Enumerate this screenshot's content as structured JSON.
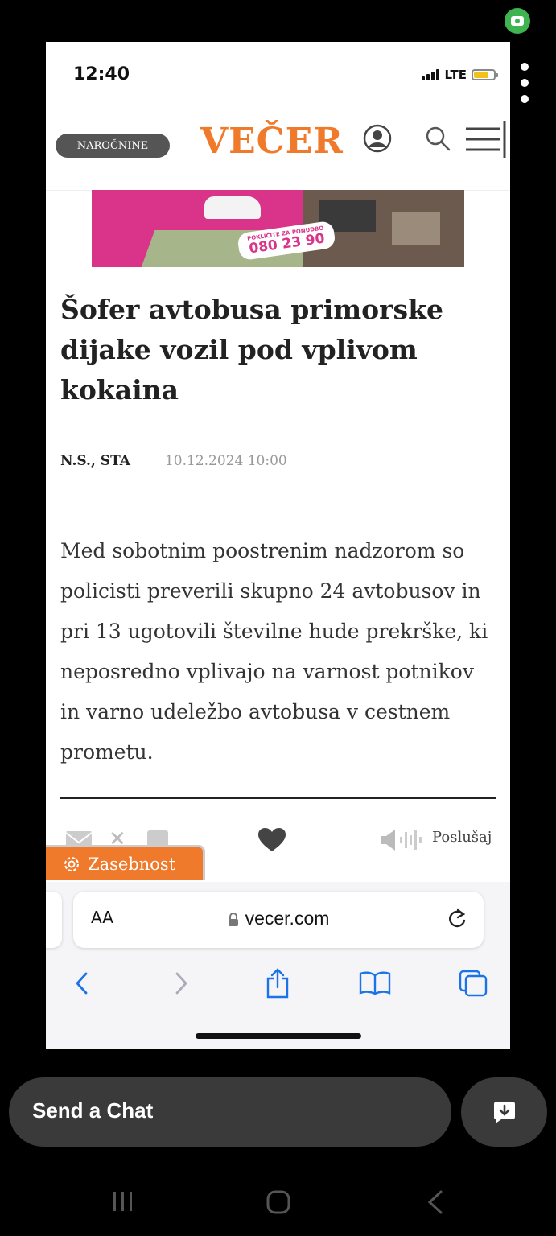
{
  "status_bar": {
    "time": "12:40",
    "network": "LTE"
  },
  "site": {
    "subscribe_label": "NAROČNINE",
    "logo": "VEČER"
  },
  "ad": {
    "small_text": "POKLIČITE ZA PONUDBO",
    "phone": "080 23 90"
  },
  "article": {
    "title": "Šofer avtobusa primorske dijake vozil pod vplivom kokaina",
    "author": "N.S., STA",
    "date": "10.12.2024 10:00",
    "lead": "Med sobotnim poostrenim nadzorom so policisti preverili skupno 24 avtobusov in pri 13 ugotovili številne hude prekrške, ki neposredno vplivajo na varnost potnikov in varno udeležbo avtobusa v cestnem prometu."
  },
  "actions": {
    "listen_label": "Poslušaj"
  },
  "privacy": {
    "label": "Zasebnost"
  },
  "browser": {
    "text_size": "AA",
    "url": "vecer.com"
  },
  "chat": {
    "placeholder": "Send a Chat"
  },
  "icons": {
    "snap_camera": "camera-icon",
    "user": "user-icon",
    "search": "search-icon",
    "menu": "menu-icon",
    "heart": "heart-icon",
    "speaker": "speaker-icon",
    "gear": "gear-icon"
  },
  "colors": {
    "brand": "#f07a2c",
    "ad": "#d9348a",
    "ios_blue": "#1a73e8"
  }
}
